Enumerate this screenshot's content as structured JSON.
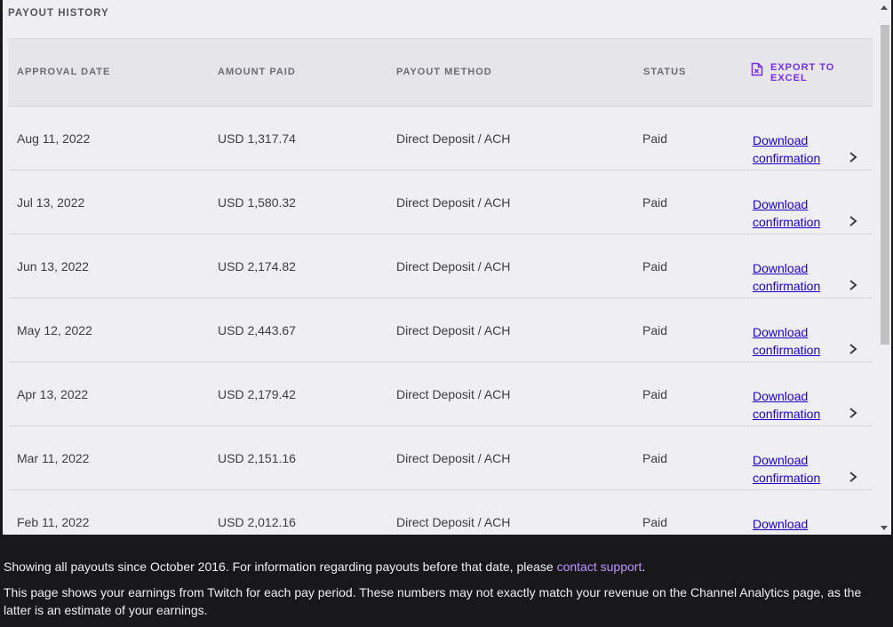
{
  "panel": {
    "title": "PAYOUT HISTORY"
  },
  "table": {
    "headers": {
      "approval_date": "APPROVAL DATE",
      "amount_paid": "AMOUNT PAID",
      "payout_method": "PAYOUT METHOD",
      "status": "STATUS",
      "export": "EXPORT TO EXCEL"
    },
    "export_icon": "excel-file-icon",
    "download_label": "Download confirmation",
    "rows": [
      {
        "date": "Aug 11, 2022",
        "amount": "USD 1,317.74",
        "method": "Direct Deposit / ACH",
        "status": "Paid"
      },
      {
        "date": "Jul 13, 2022",
        "amount": "USD 1,580.32",
        "method": "Direct Deposit / ACH",
        "status": "Paid"
      },
      {
        "date": "Jun 13, 2022",
        "amount": "USD 2,174.82",
        "method": "Direct Deposit / ACH",
        "status": "Paid"
      },
      {
        "date": "May 12, 2022",
        "amount": "USD 2,443.67",
        "method": "Direct Deposit / ACH",
        "status": "Paid"
      },
      {
        "date": "Apr 13, 2022",
        "amount": "USD 2,179.42",
        "method": "Direct Deposit / ACH",
        "status": "Paid"
      },
      {
        "date": "Mar 11, 2022",
        "amount": "USD 2,151.16",
        "method": "Direct Deposit / ACH",
        "status": "Paid"
      },
      {
        "date": "Feb 11, 2022",
        "amount": "USD 2,012.16",
        "method": "Direct Deposit / ACH",
        "status": "Paid"
      }
    ]
  },
  "footer": {
    "line1_text": "Showing all payouts since October 2016. For information regarding payouts before that date, please ",
    "line1_link": "contact support",
    "line1_end": ".",
    "line2": "This page shows your earnings from Twitch for each pay period. These numbers may not exactly match your revenue on the Channel Analytics page, as the latter is an estimate of your earnings."
  },
  "colors": {
    "accent": "#772ce8",
    "link": "#1b00c9",
    "footer_link": "#bf94ff",
    "page_bg": "#18181b",
    "panel_bg": "#efeff1"
  }
}
